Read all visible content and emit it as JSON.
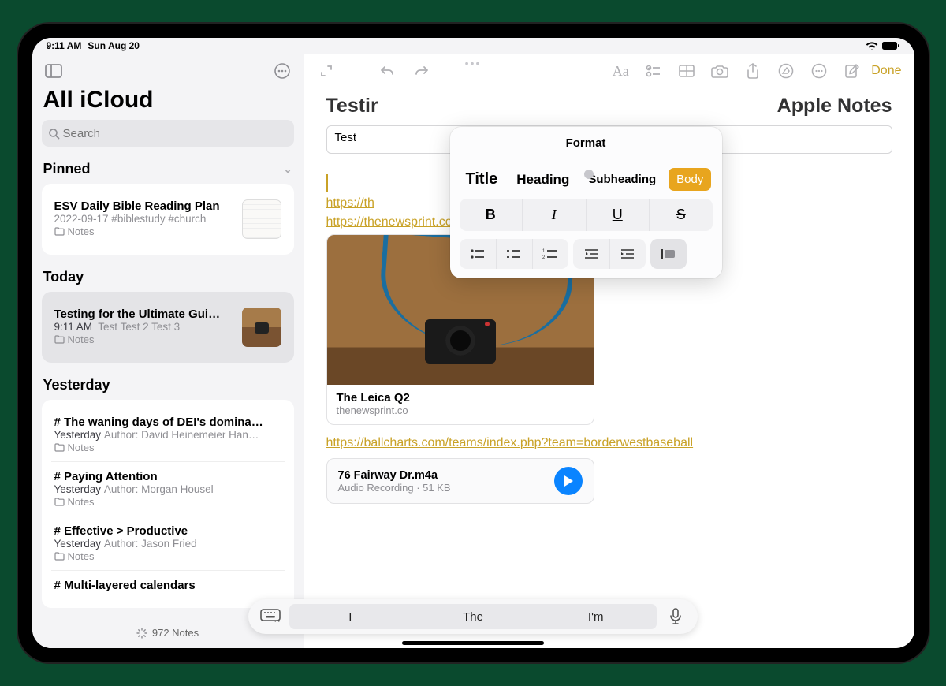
{
  "status": {
    "time": "9:11 AM",
    "date": "Sun Aug 20"
  },
  "sidebar": {
    "title": "All iCloud",
    "search_placeholder": "Search",
    "sections": {
      "pinned": "Pinned",
      "today": "Today",
      "yesterday": "Yesterday"
    },
    "pinned_note": {
      "title": "ESV Daily Bible Reading Plan",
      "sub": "2022-09-17  #biblestudy #church",
      "folder": "Notes"
    },
    "today_note": {
      "title": "Testing for the Ultimate Gui…",
      "time": "9:11 AM",
      "preview": "Test Test 2 Test 3",
      "folder": "Notes"
    },
    "yesterday": [
      {
        "title": "# The waning days of DEI's domina…",
        "time": "Yesterday",
        "preview": "Author: David Heinemeier Han…",
        "folder": "Notes"
      },
      {
        "title": "# Paying Attention",
        "time": "Yesterday",
        "preview": "Author: Morgan Housel",
        "folder": "Notes"
      },
      {
        "title": "# Effective > Productive",
        "time": "Yesterday",
        "preview": "Author: Jason Fried",
        "folder": "Notes"
      },
      {
        "title": "# Multi-layered calendars",
        "time": "",
        "preview": "",
        "folder": ""
      }
    ],
    "footer_count": "972 Notes"
  },
  "editor": {
    "done": "Done",
    "title_left": "Testir",
    "title_right": "Apple Notes",
    "table_cell1": "Test",
    "table_cell2": "",
    "link1": "https://th",
    "link2": "https://thenewsprint.co/2023/08/13/the-leica-q2/",
    "link_card": {
      "title": "The Leica Q2",
      "domain": "thenewsprint.co"
    },
    "link3": "https://ballcharts.com/teams/index.php?team=borderwestbaseball",
    "audio": {
      "filename": "76 Fairway Dr.m4a",
      "sub": "Audio Recording · 51 KB"
    }
  },
  "format": {
    "title": "Format",
    "styles": {
      "title": "Title",
      "heading": "Heading",
      "sub": "Subheading",
      "body": "Body"
    },
    "bius": {
      "b": "B",
      "i": "I",
      "u": "U",
      "s": "S"
    }
  },
  "quicktype": {
    "s1": "I",
    "s2": "The",
    "s3": "I'm"
  }
}
